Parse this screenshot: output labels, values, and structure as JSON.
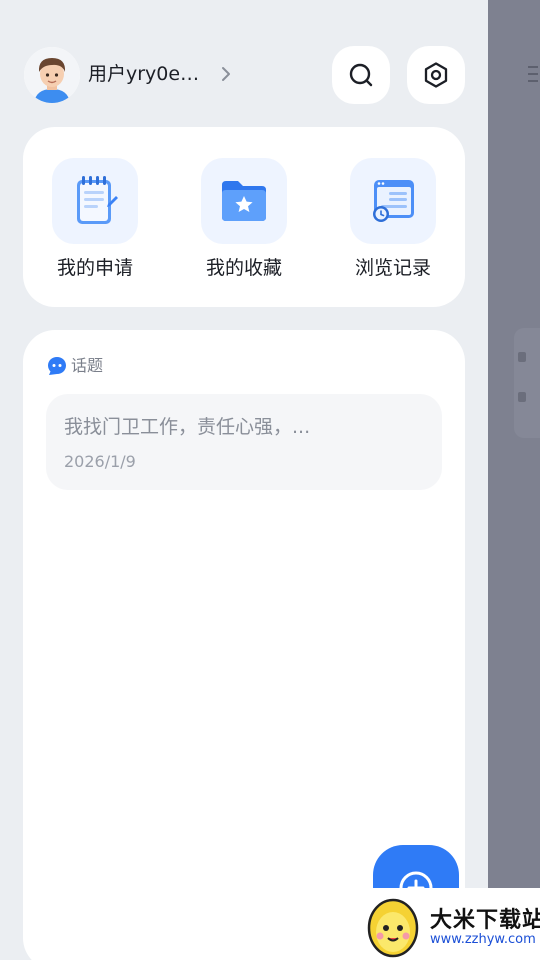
{
  "header": {
    "user_name": "用户yry0e…"
  },
  "quick_actions": [
    {
      "label": "我的申请",
      "icon": "notepad-icon"
    },
    {
      "label": "我的收藏",
      "icon": "favorites-folder-icon"
    },
    {
      "label": "浏览记录",
      "icon": "browse-history-icon"
    }
  ],
  "topics": {
    "section_label": "话题",
    "items": [
      {
        "text": "我找门卫工作，责任心强，...",
        "date": "2026/1/9"
      }
    ]
  },
  "watermark": {
    "title": "大米下载站",
    "url": "www.zzhyw.com"
  },
  "colors": {
    "accent": "#2f7bf6",
    "background": "#ebeef2",
    "overlay": "#7e8190"
  }
}
